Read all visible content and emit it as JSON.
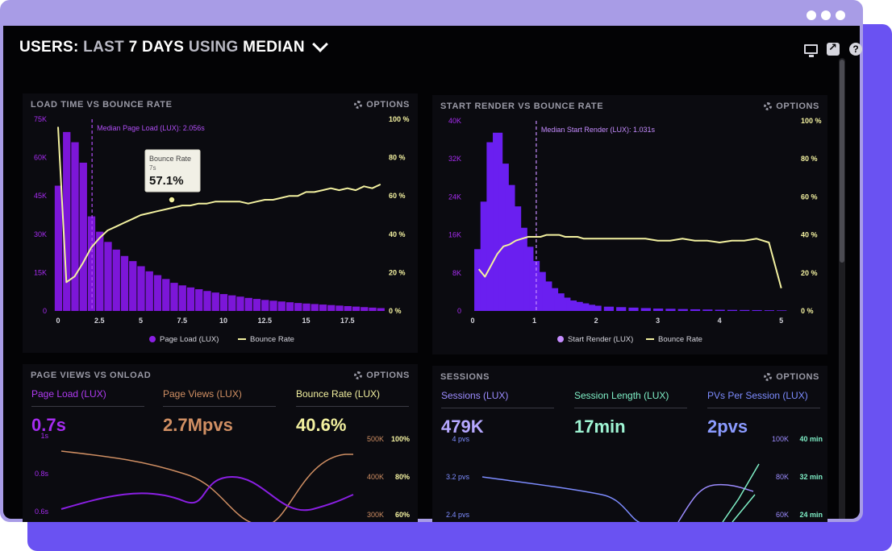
{
  "header": {
    "title_1": "USERS: ",
    "title_2": "LAST ",
    "title_3": "7 DAYS ",
    "title_4": "USING ",
    "title_5": "MEDIAN"
  },
  "colors": {
    "purple": "#8a1fe3",
    "yellow": "#f3f1a0",
    "brown": "#d08f63",
    "violet": "#7d63ff",
    "teal": "#7ff0c7",
    "options": "#9a9aa6"
  },
  "panels": {
    "load": {
      "title": "LOAD TIME VS BOUNCE RATE",
      "options": "OPTIONS",
      "median_label": "Median Page Load (LUX): 2.056s",
      "tooltip": {
        "title": "Bounce Rate",
        "sub": "7s",
        "value": "57.1%"
      },
      "legend_1": "Page Load (LUX)",
      "legend_2": "Bounce Rate"
    },
    "render": {
      "title": "START RENDER VS BOUNCE RATE",
      "options": "OPTIONS",
      "median_label": "Median Start Render (LUX): 1.031s",
      "legend_1": "Start Render (LUX)",
      "legend_2": "Bounce Rate"
    },
    "pageviews": {
      "title": "PAGE VIEWS VS ONLOAD",
      "options": "OPTIONS",
      "metrics": [
        {
          "label": "Page Load (LUX)",
          "value": "0.7s"
        },
        {
          "label": "Page Views (LUX)",
          "value": "2.7Mpvs"
        },
        {
          "label": "Bounce Rate (LUX)",
          "value": "40.6%"
        }
      ],
      "y_left": [
        "1s",
        "0.8s",
        "0.6s"
      ],
      "y_right_1": [
        "500K",
        "400K",
        "300K"
      ],
      "y_right_2": [
        "100%",
        "80%",
        "60%"
      ]
    },
    "sessions": {
      "title": "SESSIONS",
      "options": "OPTIONS",
      "metrics": [
        {
          "label": "Sessions (LUX)",
          "value": "479K"
        },
        {
          "label": "Session Length (LUX)",
          "value": "17min"
        },
        {
          "label": "PVs Per Session (LUX)",
          "value": "2pvs"
        }
      ],
      "y_left": [
        "4 pvs",
        "3.2 pvs",
        "2.4 pvs"
      ],
      "y_right_1": [
        "100K",
        "80K",
        "60K"
      ],
      "y_right_2": [
        "40 min",
        "32 min",
        "24 min"
      ]
    }
  },
  "chart_data": [
    {
      "type": "bar",
      "x": [
        0,
        0.5,
        1,
        1.5,
        2,
        2.5,
        3,
        3.5,
        4,
        4.5,
        5,
        5.5,
        6,
        6.5,
        7,
        7.5,
        8,
        8.5,
        9,
        9.5,
        10,
        10.5,
        11,
        11.5,
        12,
        12.5,
        13,
        13.5,
        14,
        14.5,
        15,
        15.5,
        16,
        16.5,
        17,
        17.5,
        18,
        18.5,
        19,
        19.5
      ],
      "series": [
        {
          "name": "Page Load (LUX)",
          "values": [
            49000,
            70000,
            66000,
            58000,
            37000,
            31000,
            27000,
            24000,
            21500,
            19500,
            17500,
            15500,
            14000,
            12500,
            11000,
            10000,
            9200,
            8500,
            7800,
            7200,
            6600,
            6100,
            5600,
            5100,
            4700,
            4300,
            4000,
            3700,
            3400,
            3100,
            2900,
            2700,
            2500,
            2300,
            2100,
            1900,
            1700,
            1500,
            1300,
            1100
          ]
        },
        {
          "name": "Bounce Rate",
          "values": [
            96,
            15,
            18,
            25,
            33,
            38,
            42,
            44,
            46,
            48,
            50,
            51,
            52,
            53,
            54,
            55,
            55,
            56,
            56,
            57,
            57,
            57,
            57,
            56,
            57,
            58,
            58,
            59,
            60,
            60,
            62,
            62,
            63,
            64,
            63,
            64,
            63,
            65,
            64,
            66
          ]
        }
      ],
      "xlabel": "",
      "ylabel": "",
      "xticks": [
        "0",
        "2.5",
        "5",
        "7.5",
        "10",
        "12.5",
        "15",
        "17.5"
      ],
      "yticks": [
        "0",
        "15K",
        "30K",
        "45K",
        "60K",
        "75K"
      ],
      "yticks_right": [
        "0 %",
        "20 %",
        "40 %",
        "60 %",
        "80 %",
        "100 %"
      ],
      "xlim": [
        0,
        20
      ],
      "ylim": [
        0,
        75000
      ],
      "ylim_right": [
        0,
        100
      ],
      "median_x": 2.056,
      "legend": "bottom-center"
    },
    {
      "type": "bar",
      "x": [
        0.1,
        0.2,
        0.3,
        0.4,
        0.5,
        0.6,
        0.7,
        0.8,
        0.9,
        1.0,
        1.1,
        1.2,
        1.3,
        1.4,
        1.5,
        1.6,
        1.7,
        1.8,
        1.9,
        2.0,
        2.2,
        2.4,
        2.6,
        2.8,
        3.0,
        3.2,
        3.4,
        3.6,
        3.8,
        4.0,
        4.2,
        4.4,
        4.6,
        4.8,
        5.0
      ],
      "series": [
        {
          "name": "Start Render (LUX)",
          "values": [
            13000,
            23000,
            35500,
            37500,
            31000,
            26500,
            22000,
            17500,
            13500,
            10500,
            8200,
            6200,
            4800,
            3700,
            2800,
            2200,
            1900,
            1600,
            1300,
            1100,
            900,
            800,
            700,
            600,
            500,
            450,
            400,
            350,
            300,
            250,
            220,
            200,
            180,
            150,
            120
          ]
        },
        {
          "name": "Bounce Rate",
          "values": [
            22,
            18,
            24,
            30,
            34,
            35,
            37,
            38,
            39,
            39,
            39,
            40,
            40,
            40,
            39,
            39,
            39,
            38,
            38,
            38,
            38,
            38,
            38,
            38,
            37,
            37,
            38,
            37,
            37,
            36,
            37,
            37,
            38,
            36,
            12
          ]
        }
      ],
      "xlabel": "",
      "ylabel": "",
      "xticks": [
        "0",
        "1",
        "2",
        "3",
        "4",
        "5"
      ],
      "yticks": [
        "0",
        "8K",
        "16K",
        "24K",
        "32K",
        "40K"
      ],
      "yticks_right": [
        "0 %",
        "20 %",
        "40 %",
        "60 %",
        "80 %",
        "100 %"
      ],
      "xlim": [
        0,
        5.2
      ],
      "ylim": [
        0,
        40000
      ],
      "ylim_right": [
        0,
        100
      ],
      "median_x": 1.031,
      "legend": "bottom-center"
    }
  ]
}
